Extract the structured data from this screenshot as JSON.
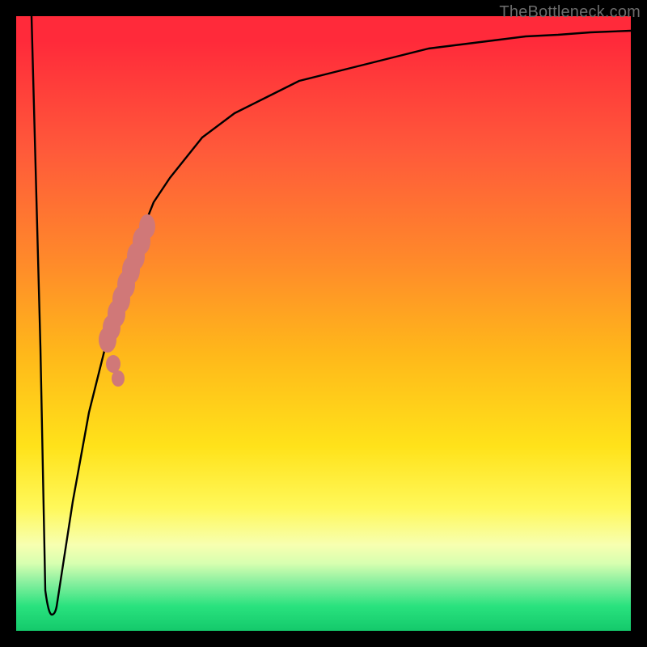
{
  "watermark": "TheBottleneck.com",
  "colors": {
    "frame": "#000000",
    "curve": "#000000",
    "marker": "#d07878",
    "gradient_top": "#ff2a3a",
    "gradient_bottom": "#14c96b"
  },
  "chart_data": {
    "type": "line",
    "title": "",
    "xlabel": "",
    "ylabel": "",
    "xlim": [
      0,
      100
    ],
    "ylim": [
      0,
      100
    ],
    "grid": false,
    "legend": false,
    "series": [
      {
        "name": "curve",
        "x": [
          2.5,
          3.9,
          5.3,
          6.6,
          9.2,
          11.8,
          14.5,
          17.1,
          19.7,
          22.4,
          25.0,
          30.3,
          35.5,
          40.8,
          46.1,
          51.3,
          56.6,
          61.8,
          67.1,
          72.4,
          77.6,
          82.9,
          88.2,
          93.4,
          100.0
        ],
        "y": [
          100.0,
          46.1,
          3.9,
          3.9,
          21.1,
          35.5,
          46.1,
          55.3,
          63.2,
          69.7,
          73.7,
          80.3,
          84.2,
          86.8,
          89.5,
          90.8,
          92.1,
          93.4,
          94.7,
          95.4,
          96.1,
          96.7,
          97.0,
          97.4,
          97.6
        ]
      }
    ],
    "highlight_segment": {
      "description": "Thickened pinkish marker band on the rising limb of the curve",
      "x_range": [
        14.5,
        22.4
      ],
      "y_range": [
        40.8,
        63.2
      ]
    }
  }
}
